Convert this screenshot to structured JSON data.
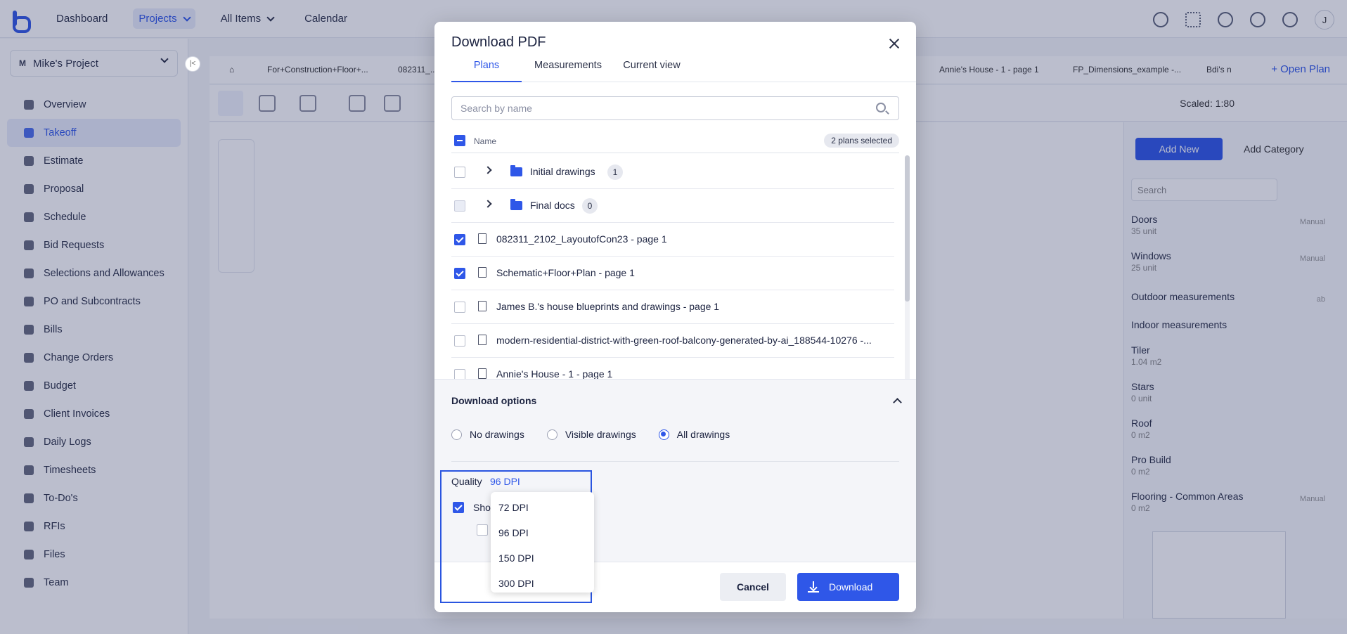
{
  "app": {
    "nav": [
      "Dashboard",
      "Projects",
      "All Items",
      "Calendar"
    ],
    "avatar_initial": "J",
    "project": {
      "badge": "M",
      "name": "Mike's Project"
    },
    "collapse_glyph": "|<",
    "sidebar": [
      "Overview",
      "Takeoff",
      "Estimate",
      "Proposal",
      "Schedule",
      "Bid Requests",
      "Selections and Allowances",
      "PO and Subcontracts",
      "Bills",
      "Change Orders",
      "Budget",
      "Client Invoices",
      "Daily Logs",
      "Timesheets",
      "To-Do's",
      "RFIs",
      "Files",
      "Team"
    ],
    "plan_tabs": [
      "For+Construction+Floor+...",
      "082311_...",
      "Annie's House - 1 - page 1",
      "FP_Dimensions_example -...",
      "Bdi's n"
    ],
    "open_plan": "+ Open Plan",
    "scaled": "Scaled: 1:80",
    "add_new": "Add New",
    "add_category": "Add Category",
    "rp_search_placeholder": "Search",
    "rp_items": [
      {
        "name": "Doors",
        "sub": "35 unit",
        "tag": "Manual"
      },
      {
        "name": "Windows",
        "sub": "25 unit",
        "tag": "Manual"
      },
      {
        "name": "Outdoor measurements",
        "sub": "",
        "tag": "ab"
      },
      {
        "name": "Indoor measurements",
        "sub": "",
        "tag": ""
      },
      {
        "name": "Tiler",
        "sub": "1.04 m2",
        "tag": ""
      },
      {
        "name": "Stars",
        "sub": "0 unit",
        "tag": ""
      },
      {
        "name": "Roof",
        "sub": "0 m2",
        "tag": ""
      },
      {
        "name": "Pro Build",
        "sub": "0 m2",
        "tag": ""
      },
      {
        "name": "Flooring - Common Areas",
        "sub": "0 m2",
        "tag": "Manual"
      }
    ]
  },
  "modal": {
    "title": "Download PDF",
    "tabs": [
      "Plans",
      "Measurements",
      "Current view"
    ],
    "active_tab": "Plans",
    "search_placeholder": "Search by name",
    "name_header": "Name",
    "selected_pill": "2 plans selected",
    "rows": [
      {
        "type": "folder",
        "label": "Initial drawings",
        "count": "1",
        "checked": false
      },
      {
        "type": "folder",
        "label": "Final docs",
        "count": "0",
        "checked": false,
        "disabled": true
      },
      {
        "type": "file",
        "label": "082311_2102_LayoutofCon23 - page 1",
        "checked": true
      },
      {
        "type": "file",
        "label": "Schematic+Floor+Plan - page 1",
        "checked": true
      },
      {
        "type": "file",
        "label": "James B.'s house blueprints and drawings - page 1",
        "checked": false
      },
      {
        "type": "file",
        "label": "modern-residential-district-with-green-roof-balcony-generated-by-ai_188544-10276 -...",
        "checked": false
      },
      {
        "type": "file",
        "label": "Annie's House - 1 - page 1",
        "checked": false
      }
    ],
    "options": {
      "title": "Download options",
      "drawings": [
        "No drawings",
        "Visible drawings",
        "All drawings"
      ],
      "selected_drawing": "All drawings",
      "quality_label": "Quality",
      "quality_value": "96 DPI",
      "show_label": "Sho",
      "quality_options": [
        "72 DPI",
        "96 DPI",
        "150 DPI",
        "300 DPI"
      ]
    },
    "cancel": "Cancel",
    "download": "Download"
  },
  "colors": {
    "accent": "#2f57e8",
    "highlight_border": "#2a55e0",
    "overlay": "rgba(30,40,90,0.30)"
  },
  "icons": [
    "logo-icon",
    "help-icon",
    "apps-grid-icon",
    "gear-icon",
    "users-icon",
    "bell-icon",
    "close-icon",
    "search-icon",
    "folder-icon",
    "file-icon",
    "chevron-right-icon",
    "chevron-up-icon",
    "download-icon"
  ]
}
